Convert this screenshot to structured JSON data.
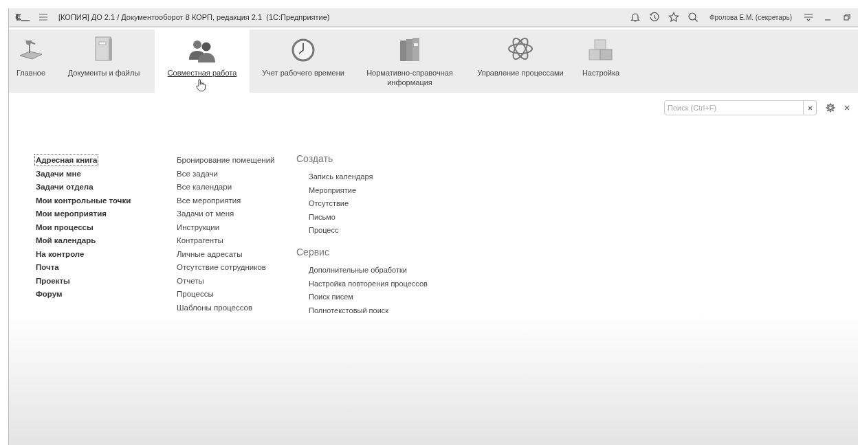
{
  "window": {
    "title": "[КОПИЯ] ДО 2.1 / Документооборот 8 КОРП, редакция 2.1  (1С:Предприятие)",
    "user": "Фролова Е.М. (секретарь)"
  },
  "sections": [
    {
      "label": "Главное",
      "selected": false
    },
    {
      "label": "Документы и файлы",
      "selected": false
    },
    {
      "label": "Совместная работа",
      "selected": true
    },
    {
      "label": "Учет рабочего времени",
      "selected": false
    },
    {
      "label": "Нормативно-справочная информация",
      "selected": false
    },
    {
      "label": "Управление процессами",
      "selected": false
    },
    {
      "label": "Настройка",
      "selected": false
    }
  ],
  "search": {
    "placeholder": "Поиск (Ctrl+F)"
  },
  "main_links": [
    {
      "label": "Адресная книга",
      "focused": true
    },
    {
      "label": "Задачи мне",
      "focused": false
    },
    {
      "label": "Задачи отдела",
      "focused": false
    },
    {
      "label": "Мои контрольные точки",
      "focused": false
    },
    {
      "label": "Мои мероприятия",
      "focused": false
    },
    {
      "label": "Мои процессы",
      "focused": false
    },
    {
      "label": "Мой календарь",
      "focused": false
    },
    {
      "label": "На контроле",
      "focused": false
    },
    {
      "label": "Почта",
      "focused": false
    },
    {
      "label": "Проекты",
      "focused": false
    },
    {
      "label": "Форум",
      "focused": false
    }
  ],
  "links": [
    "Бронирование помещений",
    "Все задачи",
    "Все календари",
    "Все мероприятия",
    "Задачи от меня",
    "Инструкции",
    "Контрагенты",
    "Личные адресаты",
    "Отсутствие сотрудников",
    "Отчеты",
    "Процессы",
    "Шаблоны процессов"
  ],
  "groups": [
    {
      "title": "Создать",
      "items": [
        "Запись календаря",
        "Мероприятие",
        "Отсутствие",
        "Письмо",
        "Процесс"
      ]
    },
    {
      "title": "Сервис",
      "items": [
        "Дополнительные обработки",
        "Настройка повторения процессов",
        "Поиск писем",
        "Полнотекстовый поиск"
      ]
    }
  ]
}
